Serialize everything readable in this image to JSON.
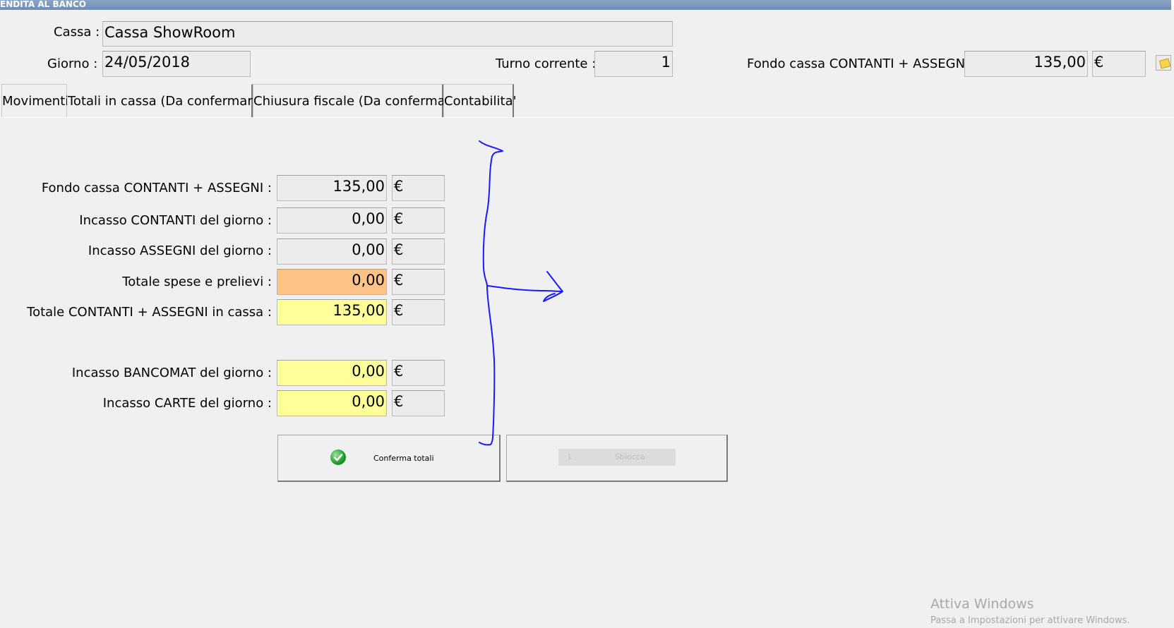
{
  "window": {
    "title": "ENDITA AL BANCO"
  },
  "header": {
    "cassa_label": "Cassa :",
    "cassa_value": "Cassa ShowRoom",
    "giorno_label": "Giorno :",
    "giorno_value": "24/05/2018",
    "turno_label": "Turno corrente :",
    "turno_value": "1",
    "fondo_label": "Fondo cassa CONTANTI + ASSEGNI :",
    "fondo_value": "135,00",
    "fondo_currency": "€"
  },
  "tabs": [
    {
      "label": "Movimenti"
    },
    {
      "label": "Totali in cassa (Da confermare)"
    },
    {
      "label": "Chiusura fiscale (Da confermare)"
    },
    {
      "label": "Contabilita'"
    }
  ],
  "totals": {
    "rows": [
      {
        "label": "Fondo cassa CONTANTI + ASSEGNI :",
        "value": "135,00",
        "currency": "€"
      },
      {
        "label": "Incasso CONTANTI del giorno :",
        "value": "0,00",
        "currency": "€"
      },
      {
        "label": "Incasso ASSEGNI del giorno :",
        "value": "0,00",
        "currency": "€"
      },
      {
        "label": "Totale spese e prelievi :",
        "value": "0,00",
        "currency": "€"
      },
      {
        "label": "Totale CONTANTI + ASSEGNI in cassa :",
        "value": "135,00",
        "currency": "€"
      },
      {
        "label": "Incasso BANCOMAT del giorno :",
        "value": "0,00",
        "currency": "€"
      },
      {
        "label": "Incasso CARTE del giorno :",
        "value": "0,00",
        "currency": "€"
      }
    ]
  },
  "buttons": {
    "confirm_label": "Conferma totali",
    "confirm_icon": "check-icon",
    "unlock_label": "Sblocca",
    "unlock_prefix": "1"
  },
  "watermark": {
    "line1": "Attiva Windows",
    "line2": "Passa a Impostazioni per attivare Windows."
  },
  "colors": {
    "orange_field": "#ffc388",
    "yellow_field": "#ffff99",
    "annotation": "#1a1aff"
  }
}
